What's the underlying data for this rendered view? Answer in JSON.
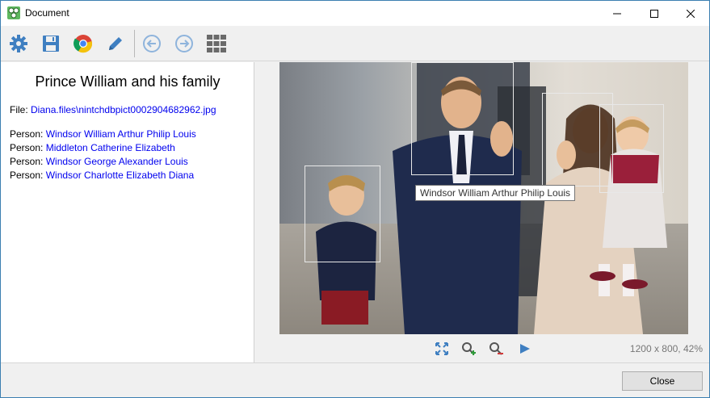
{
  "window": {
    "title": "Document",
    "app_icon": "app-logo-icon",
    "controls": [
      "minimize-icon",
      "maximize-icon",
      "close-icon"
    ]
  },
  "toolbar": {
    "buttons": [
      {
        "icon": "gear-icon",
        "color": "#3f7fc1"
      },
      {
        "icon": "save-icon",
        "color": "#3f7fc1"
      },
      {
        "icon": "chrome-icon"
      },
      {
        "icon": "pencil-icon",
        "color": "#3f7fc1"
      },
      {
        "icon": "back-arrow-icon",
        "color": "#8fb4dc"
      },
      {
        "icon": "forward-arrow-icon",
        "color": "#8fb4dc"
      },
      {
        "icon": "grid-icon",
        "color": "#6a6a6a"
      }
    ]
  },
  "document": {
    "title": "Prince William and his family",
    "file_label": "File:",
    "file_name": "Diana.files\\nintchdbpict0002904682962.jpg",
    "person_label": "Person:",
    "persons": [
      "Windsor William Arthur Philip Louis",
      "Middleton Catherine Elizabeth",
      "Windsor George Alexander Louis",
      "Windsor Charlotte Elizabeth Diana"
    ]
  },
  "viewer": {
    "tooltip": "Windsor William Arthur Philip Louis",
    "image_info": "1200 x 800, 42%",
    "controls": [
      "fit-icon",
      "zoom-in-icon",
      "zoom-out-icon",
      "play-icon"
    ],
    "accent": "#3f7fc1"
  },
  "footer": {
    "close_label": "Close"
  }
}
